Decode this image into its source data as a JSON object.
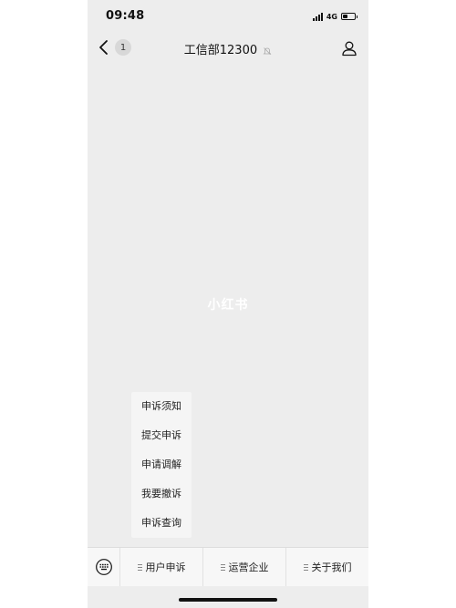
{
  "status": {
    "time": "09:48",
    "network": "4G"
  },
  "nav": {
    "back_badge": "1",
    "title": "工信部12300"
  },
  "watermark": "小红书",
  "popup_menu": [
    "申诉须知",
    "提交申诉",
    "申请调解",
    "我要撤诉",
    "申诉查询"
  ],
  "bottom_menu": [
    "用户申诉",
    "运营企业",
    "关于我们"
  ]
}
